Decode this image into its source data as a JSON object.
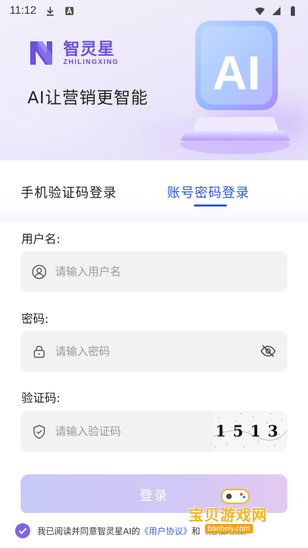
{
  "status_bar": {
    "time": "11:12",
    "icons": [
      "download-icon",
      "a-badge-icon",
      "wifi-icon",
      "signal-icon",
      "battery-icon"
    ]
  },
  "brand": {
    "name_cn": "智灵星",
    "name_en": "ZHILINGXING",
    "slogan": "AI让营销更智能",
    "hero_badge": "AI",
    "accent_color": "#6b4fe0"
  },
  "tabs": [
    {
      "label": "手机验证码登录",
      "active": false
    },
    {
      "label": "账号密码登录",
      "active": true
    }
  ],
  "form": {
    "username": {
      "label": "用户名:",
      "placeholder": "请输入用户名",
      "value": ""
    },
    "password": {
      "label": "密码:",
      "placeholder": "请输入密码",
      "value": ""
    },
    "captcha": {
      "label": "验证码:",
      "placeholder": "请输入验证码",
      "value": "",
      "image_text": "1513"
    }
  },
  "login_button": "登录",
  "agreement": {
    "checked": true,
    "prefix": "我已阅读并同意智灵星AI的",
    "user_agreement": "《用户协议》",
    "and": "和",
    "privacy_policy": "《隐私政策》"
  },
  "watermark": {
    "text": "宝贝游戏网",
    "url": "baobeiy.com"
  }
}
